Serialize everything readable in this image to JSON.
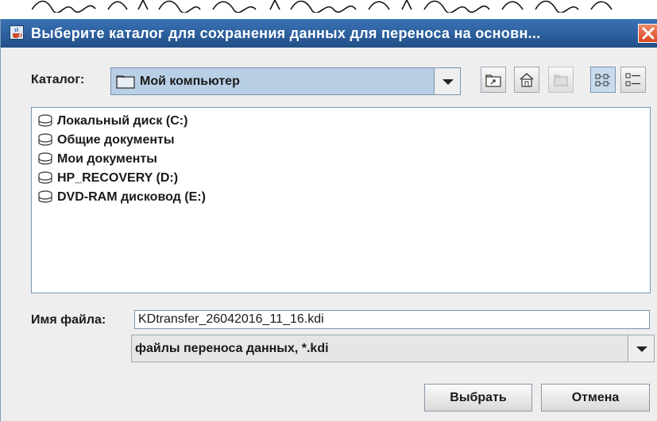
{
  "dialog": {
    "title": "Выберите каталог для сохранения данных для переноса на основн...",
    "close_icon": "close-icon",
    "app_icon": "java-cup-icon"
  },
  "look_in": {
    "label": "Каталог:",
    "value": "Мой компьютер",
    "icon": "folder-icon"
  },
  "toolbar": {
    "buttons": [
      {
        "name": "up-one-level-button",
        "icon": "up-folder-icon",
        "enabled": true
      },
      {
        "name": "home-button",
        "icon": "home-icon",
        "enabled": true
      },
      {
        "name": "new-folder-button",
        "icon": "new-folder-icon",
        "enabled": false
      },
      {
        "name": "list-view-button",
        "icon": "list-view-icon",
        "enabled": true,
        "selected": true
      },
      {
        "name": "details-view-button",
        "icon": "details-view-icon",
        "enabled": true
      }
    ]
  },
  "file_list": {
    "items": [
      {
        "label": "Локальный диск (C:)",
        "icon": "disk-icon"
      },
      {
        "label": "Общие документы",
        "icon": "disk-icon"
      },
      {
        "label": "Мои документы",
        "icon": "disk-icon"
      },
      {
        "label": "HP_RECOVERY (D:)",
        "icon": "disk-icon"
      },
      {
        "label": "DVD-RAM дисковод (E:)",
        "icon": "disk-icon"
      }
    ]
  },
  "file_name": {
    "label": "Имя файла:",
    "value": "KDtransfer_26042016_11_16.kdi"
  },
  "file_type": {
    "value": "файлы переноса данных, *.kdi"
  },
  "buttons": {
    "ok_label": "Выбрать",
    "cancel_label": "Отмена"
  },
  "colors": {
    "titlebar": "#2c5f9d",
    "combo_bg": "#b8cfe5",
    "dialog_bg": "#eeeeee",
    "close_button": "#e25a30"
  }
}
